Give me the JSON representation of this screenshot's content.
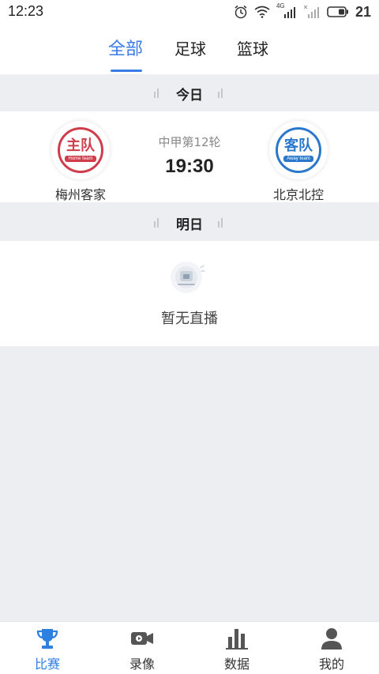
{
  "status_bar": {
    "time": "12:23",
    "network_label": "4G",
    "battery_level": "21",
    "icons": [
      "alarm-icon",
      "wifi-icon",
      "signal-icon",
      "signal-icon",
      "battery-icon"
    ]
  },
  "tabs": [
    {
      "label": "全部",
      "active": true
    },
    {
      "label": "足球",
      "active": false
    },
    {
      "label": "篮球",
      "active": false
    }
  ],
  "sections": {
    "today": "今日",
    "tomorrow": "明日"
  },
  "match": {
    "league_round": "中甲第12轮",
    "time": "19:30",
    "home": {
      "name": "梅州客家",
      "badge_text": "主队",
      "badge_sub": "Home team",
      "color": "#cf3c4b"
    },
    "away": {
      "name": "北京北控",
      "badge_text": "客队",
      "badge_sub": "Away team",
      "color": "#2a78cc"
    }
  },
  "empty_state": {
    "text": "暂无直播",
    "icon": "tv-empty-icon"
  },
  "bottom_nav": [
    {
      "label": "比赛",
      "icon": "trophy-icon",
      "active": true
    },
    {
      "label": "录像",
      "icon": "video-camera-icon",
      "active": false
    },
    {
      "label": "数据",
      "icon": "bar-chart-icon",
      "active": false
    },
    {
      "label": "我的",
      "icon": "user-icon",
      "active": false
    }
  ],
  "colors": {
    "accent": "#3a7be8",
    "background": "#eceef1"
  }
}
